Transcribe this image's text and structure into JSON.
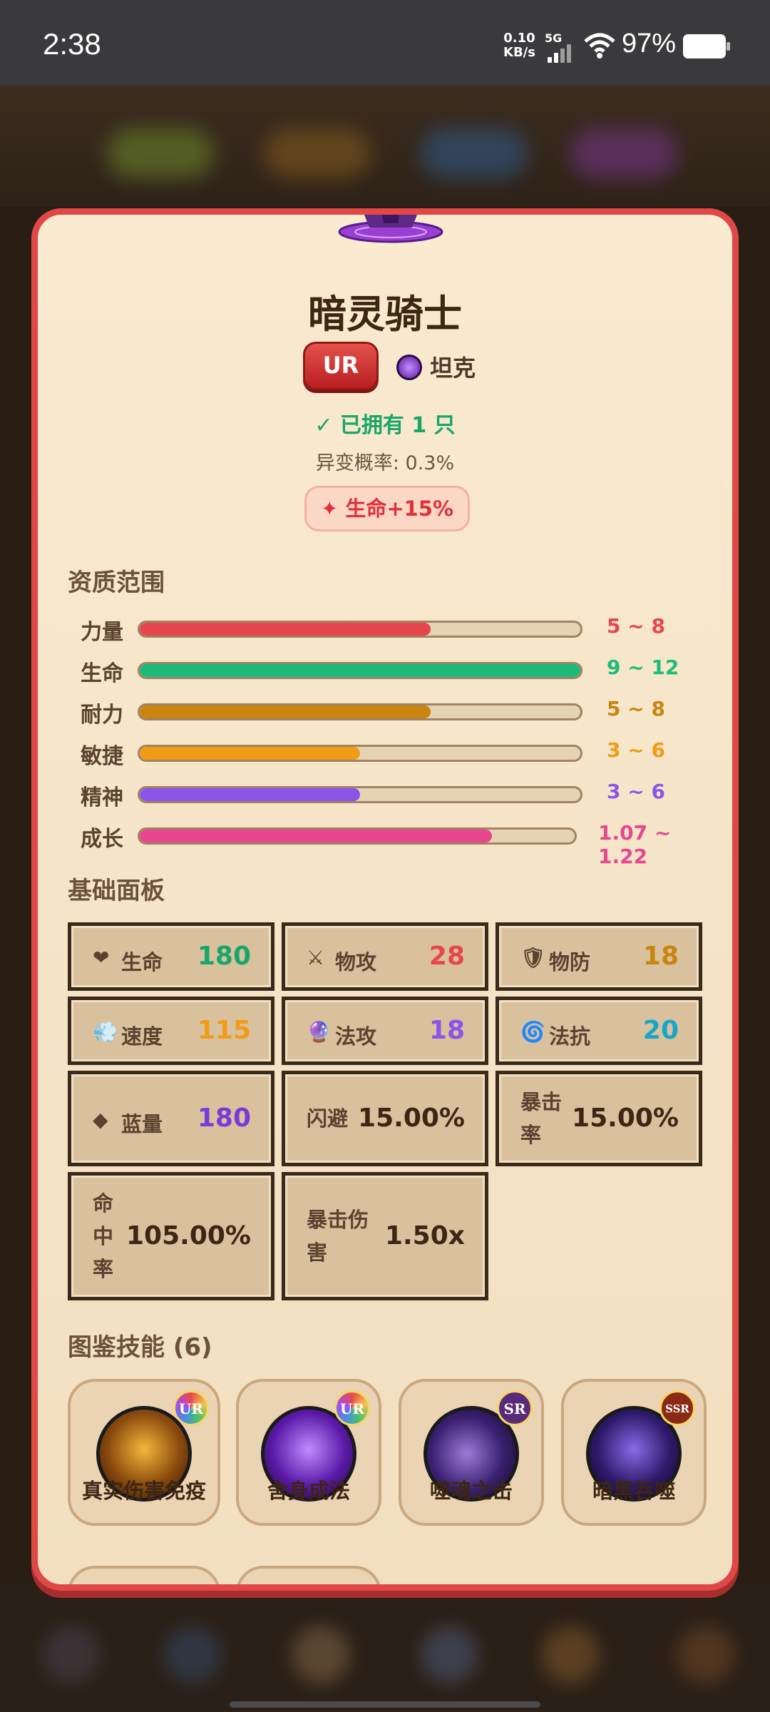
{
  "status_bar": {
    "time": "2:38",
    "net_speed_value": "0.10",
    "net_speed_unit": "KB/s",
    "signal": "5G",
    "battery": "97%"
  },
  "creature": {
    "name": "暗灵骑士",
    "rarity": "UR",
    "role": "坦克",
    "owned": "✓ 已拥有 1 只",
    "mutation": "异变概率: 0.3%",
    "bonus": "✦ 生命+15%"
  },
  "aptitude": {
    "title": "资质范围",
    "rows": [
      {
        "label": "力量",
        "range": "5 ~ 8",
        "fill": 0.66,
        "color": "#e5474d"
      },
      {
        "label": "生命",
        "range": "9 ~ 12",
        "fill": 1.0,
        "color": "#1dbb7a"
      },
      {
        "label": "耐力",
        "range": "5 ~ 8",
        "fill": 0.66,
        "color": "#c9850f"
      },
      {
        "label": "敏捷",
        "range": "3 ~ 6",
        "fill": 0.5,
        "color": "#f19b16"
      },
      {
        "label": "精神",
        "range": "3 ~ 6",
        "fill": 0.5,
        "color": "#8a55e8"
      },
      {
        "label": "成长",
        "range": "1.07 ~ 1.22",
        "fill": 0.81,
        "color": "#e8468f"
      }
    ]
  },
  "base_panel": {
    "title": "基础面板",
    "stats": [
      {
        "icon": "❤",
        "label": "生命",
        "value": "180",
        "color": "#1aa66a"
      },
      {
        "icon": "⚔",
        "label": "物攻",
        "value": "28",
        "color": "#e5474d"
      },
      {
        "icon": "🛡",
        "label": "物防",
        "value": "18",
        "color": "#c9850f"
      },
      {
        "icon": "💨",
        "label": "速度",
        "value": "115",
        "color": "#f19b16"
      },
      {
        "icon": "🔮",
        "label": "法攻",
        "value": "18",
        "color": "#8a55e8"
      },
      {
        "icon": "🌀",
        "label": "法抗",
        "value": "20",
        "color": "#16a6c9"
      },
      {
        "icon": "◆",
        "label": "蓝量",
        "value": "180",
        "color": "#7a3ad6"
      },
      {
        "label": "闪避",
        "value": "15.00%",
        "color": "#3d2614"
      },
      {
        "label": "暴击率",
        "value": "15.00%",
        "color": "#3d2614"
      },
      {
        "label": "命中率",
        "value": "105.00%",
        "color": "#3d2614"
      },
      {
        "label": "暴击伤害",
        "value": "1.50x",
        "color": "#3d2614"
      }
    ]
  },
  "skills": {
    "title": "图鉴技能 (6)",
    "items": [
      {
        "name": "真实伤害免疫",
        "rarity": "UR"
      },
      {
        "name": "舍身成法",
        "rarity": "UR"
      },
      {
        "name": "噬魂之击",
        "rarity": "SR"
      },
      {
        "name": "暗黑吞噬",
        "rarity": "SSR"
      }
    ]
  }
}
